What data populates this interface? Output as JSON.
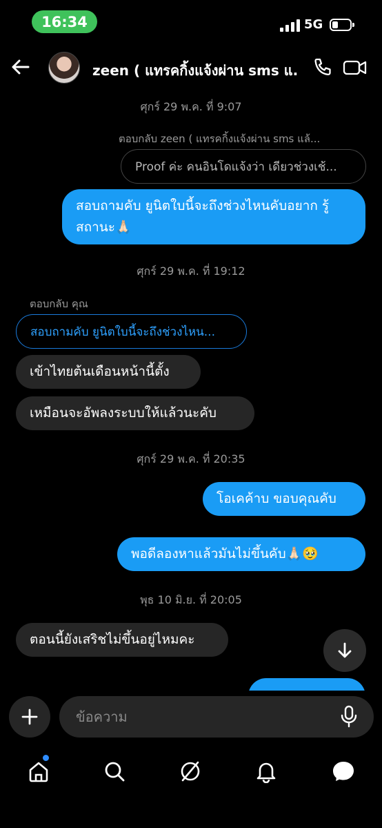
{
  "status_bar": {
    "time": "16:34",
    "network": "5G",
    "time_pill_color": "#3fc25b"
  },
  "header": {
    "contact_name": "zeen ( แทรคกิ้งแจ้งผ่าน sms แ...",
    "icons": [
      "back-arrow-icon",
      "phone-icon",
      "video-camera-icon"
    ]
  },
  "messages": {
    "ts1": "ศุกร์ 29 พ.ค. ที่ 9:07",
    "reply1_label": "ตอบกลับ zeen ( แทรคกิ้งแจ้งผ่าน sms แล้...",
    "reply1_quote": "Proof ค่ะ คนอินโดแจ้งว่า เดียวช่วงเช้...",
    "sent1": "สอบถามคับ ยูนิตใบนี้จะถึงช่วงไหนคับอยาก รู้สถานะ🙏🏻",
    "ts2": "ศุกร์ 29 พ.ค. ที่ 19:12",
    "reply2_label": "ตอบกลับ คุณ",
    "reply2_quote": "สอบถามคับ ยูนิตใบนี้จะถึงช่วงไหน...",
    "recv1": "เข้าไทยต้นเดือนหน้านี้ตั้ง",
    "recv2": "เหมือนจะอัพลงระบบให้แล้วนะคับ",
    "ts3": "ศุกร์ 29 พ.ค. ที่ 20:35",
    "sent2": "โอเคค้าบ ขอบคุณคับ",
    "sent3": "พอดีลองหาแล้วมันไม่ขึ้นคับ🙏🏻🥹",
    "ts4": "พุธ 10 มิ.ย. ที่ 20:05",
    "recv3": "ตอนนี้ยังเสริชไม่ขึ้นอยู่ไหมคะ"
  },
  "composer": {
    "placeholder": "ข้อความ"
  },
  "colors": {
    "sent_bubble": "#1a9cf5",
    "received_bubble": "#262626",
    "background": "#000000"
  }
}
